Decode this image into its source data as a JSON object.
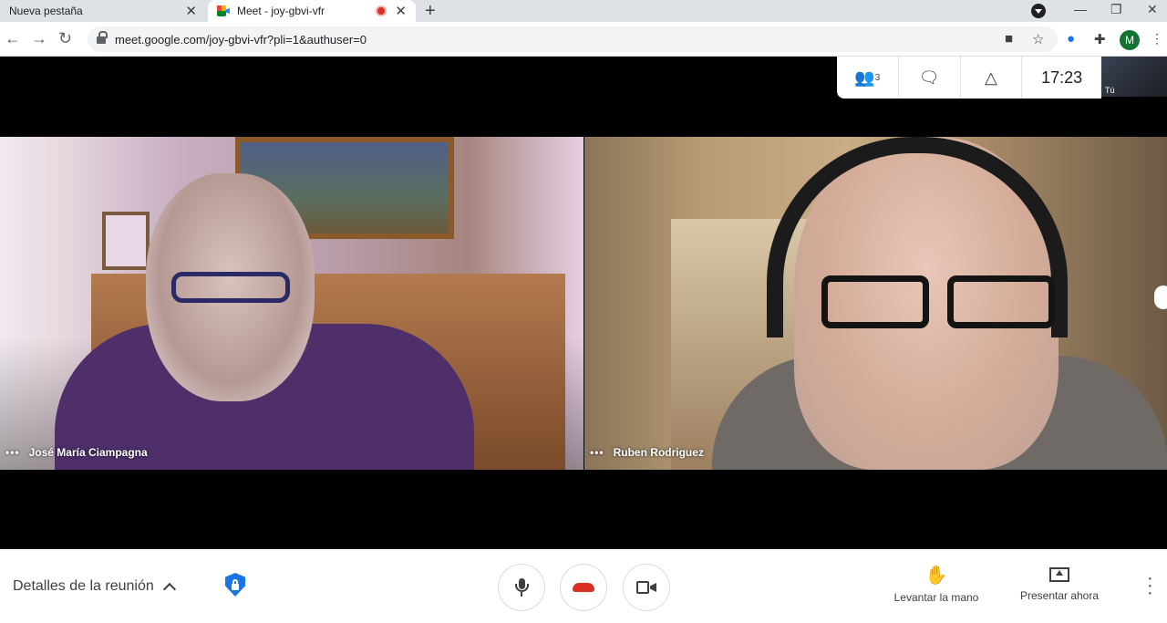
{
  "browser": {
    "tabs": [
      {
        "label": "Nueva pestaña"
      },
      {
        "label": "Meet - joy-gbvi-vfr"
      }
    ],
    "new_tab_symbol": "+",
    "close_symbol": "✕",
    "url": "meet.google.com/joy-gbvi-vfr?pli=1&authuser=0",
    "profile_initial": "M"
  },
  "meet": {
    "clock": "17:23",
    "participants_count": "3",
    "self_label": "Tú",
    "participants": [
      {
        "name": "José María Ciampagna"
      },
      {
        "name": "Ruben Rodriguez"
      }
    ],
    "bottom": {
      "details_label": "Detalles de la reunión",
      "raise_hand_label": "Levantar la mano",
      "present_label": "Presentar ahora"
    }
  },
  "colors": {
    "hangup": "#d93025",
    "shield": "#1a73e8",
    "avatar": "#137333"
  },
  "icons": [
    "back-icon",
    "forward-icon",
    "reload-icon",
    "lock-icon",
    "camera-blocked-icon",
    "star-icon",
    "mic-icon",
    "extensions-icon",
    "people-icon",
    "chat-icon",
    "activities-icon",
    "shield-icon",
    "hangup-icon",
    "camera-icon",
    "hand-icon",
    "present-icon",
    "more-vert-icon"
  ]
}
